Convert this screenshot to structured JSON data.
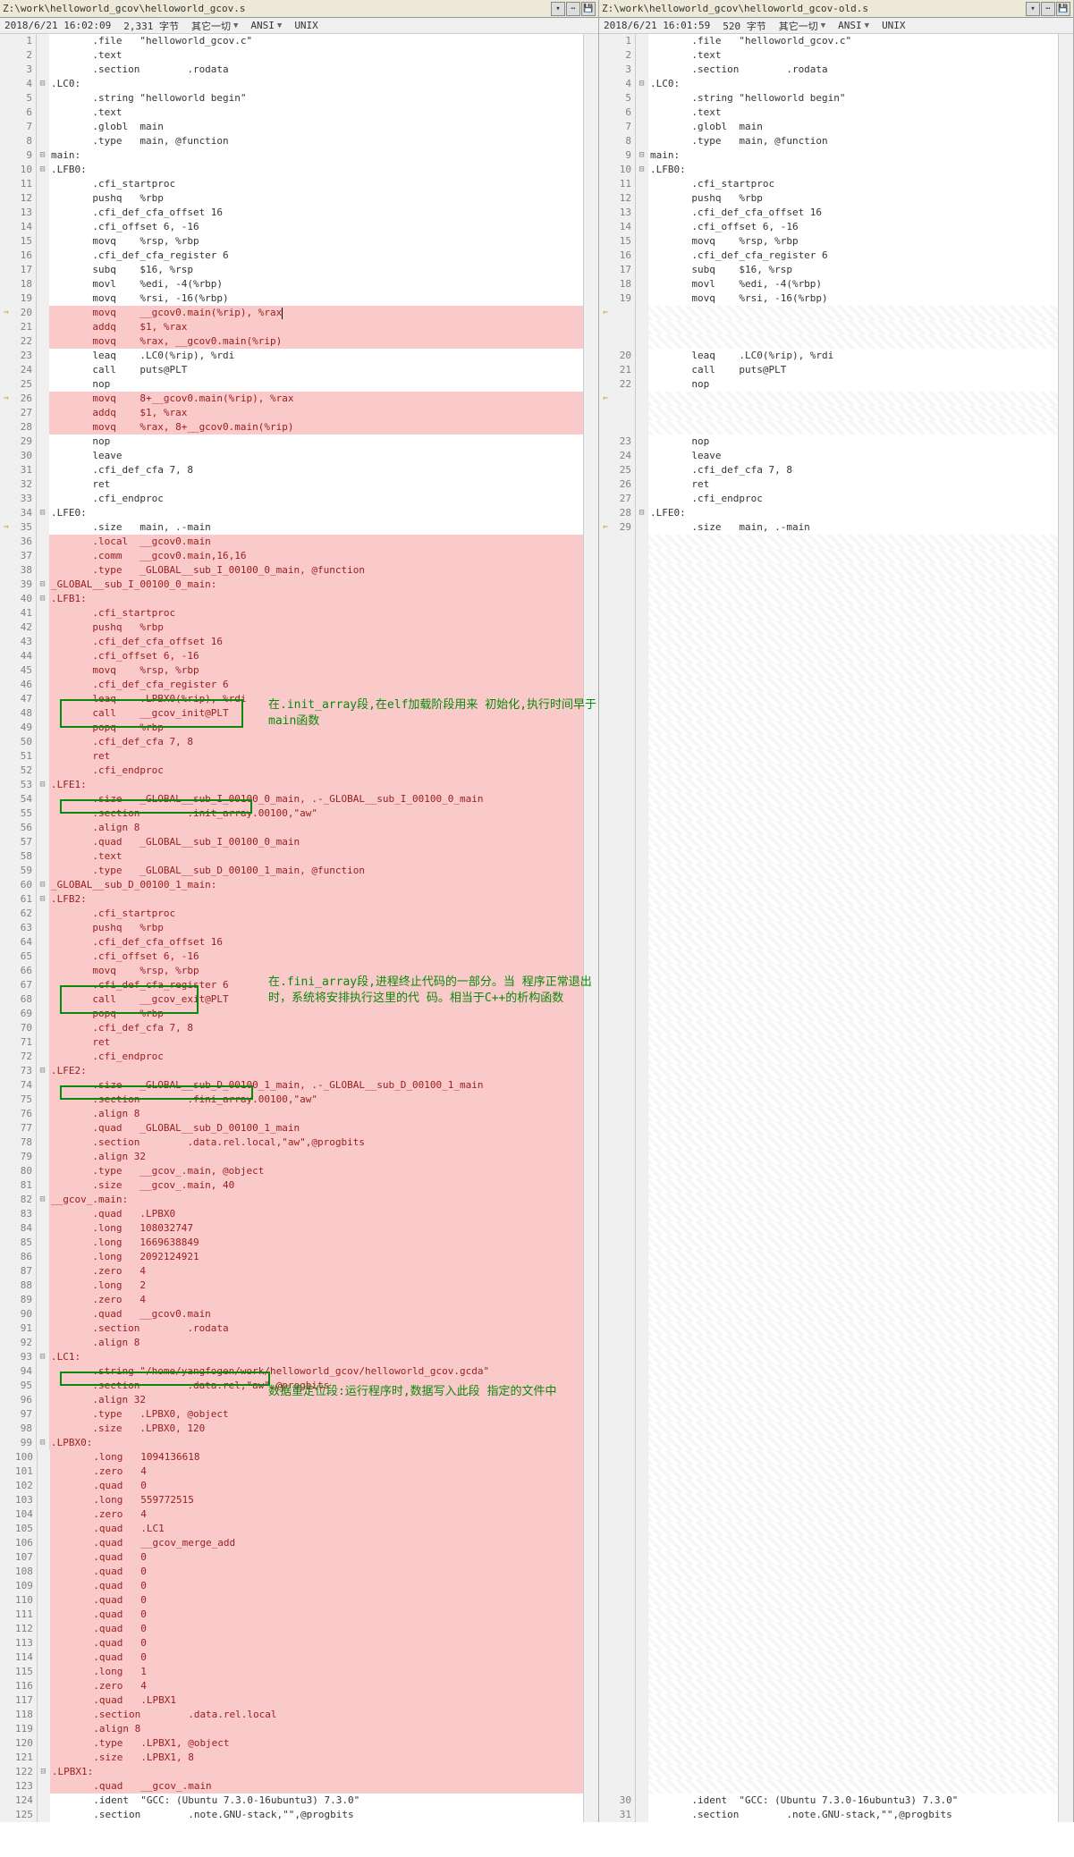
{
  "left": {
    "path": "Z:\\work\\helloworld_gcov\\helloworld_gcov.s",
    "status": {
      "date": "2018/6/21 16:02:09",
      "bytes": "2,331 字节",
      "menu": "其它一切",
      "enc": "ANSI",
      "eol": "UNIX"
    },
    "annotations": {
      "a1": "在.init_array段,在elf加载阶段用来\n初始化,执行时间早于main函数",
      "a2": "在.fini_array段,进程终止代码的一部分。当\n程序正常退出时，系统将安排执行这里的代\n码。相当于C++的析构函数",
      "a3": "数据重定位段:运行程序时,数据写入此段\n指定的文件中"
    },
    "lines": [
      {
        "n": 1,
        "t": "       .file   \"helloworld_gcov.c\"",
        "c": "norm"
      },
      {
        "n": 2,
        "t": "       .text",
        "c": "norm"
      },
      {
        "n": 3,
        "t": "       .section        .rodata",
        "c": "norm"
      },
      {
        "n": 4,
        "t": ".LC0:",
        "c": "norm"
      },
      {
        "n": 5,
        "t": "       .string \"helloworld begin\"",
        "c": "norm"
      },
      {
        "n": 6,
        "t": "       .text",
        "c": "norm"
      },
      {
        "n": 7,
        "t": "       .globl  main",
        "c": "norm"
      },
      {
        "n": 8,
        "t": "       .type   main, @function",
        "c": "norm"
      },
      {
        "n": 9,
        "t": "main:",
        "c": "norm"
      },
      {
        "n": 10,
        "t": ".LFB0:",
        "c": "norm"
      },
      {
        "n": 11,
        "t": "       .cfi_startproc",
        "c": "norm"
      },
      {
        "n": 12,
        "t": "       pushq   %rbp",
        "c": "norm"
      },
      {
        "n": 13,
        "t": "       .cfi_def_cfa_offset 16",
        "c": "norm"
      },
      {
        "n": 14,
        "t": "       .cfi_offset 6, -16",
        "c": "norm"
      },
      {
        "n": 15,
        "t": "       movq    %rsp, %rbp",
        "c": "norm"
      },
      {
        "n": 16,
        "t": "       .cfi_def_cfa_register 6",
        "c": "norm"
      },
      {
        "n": 17,
        "t": "       subq    $16, %rsp",
        "c": "norm"
      },
      {
        "n": 18,
        "t": "       movl    %edi, -4(%rbp)",
        "c": "norm"
      },
      {
        "n": 19,
        "t": "       movq    %rsi, -16(%rbp)",
        "c": "norm"
      },
      {
        "n": 20,
        "t": "       movq    __gcov0.main(%rip), %rax",
        "bg": "red",
        "ic": "⇒",
        "cur": true
      },
      {
        "n": 21,
        "t": "       addq    $1, %rax",
        "bg": "red"
      },
      {
        "n": 22,
        "t": "       movq    %rax, __gcov0.main(%rip)",
        "bg": "red"
      },
      {
        "n": 23,
        "t": "       leaq    .LC0(%rip), %rdi",
        "c": "norm"
      },
      {
        "n": 24,
        "t": "       call    puts@PLT",
        "c": "norm"
      },
      {
        "n": 25,
        "t": "       nop",
        "c": "norm"
      },
      {
        "n": 26,
        "t": "       movq    8+__gcov0.main(%rip), %rax",
        "bg": "red",
        "ic": "⇒"
      },
      {
        "n": 27,
        "t": "       addq    $1, %rax",
        "bg": "red"
      },
      {
        "n": 28,
        "t": "       movq    %rax, 8+__gcov0.main(%rip)",
        "bg": "red"
      },
      {
        "n": 29,
        "t": "       nop",
        "c": "norm"
      },
      {
        "n": 30,
        "t": "       leave",
        "c": "norm"
      },
      {
        "n": 31,
        "t": "       .cfi_def_cfa 7, 8",
        "c": "norm"
      },
      {
        "n": 32,
        "t": "       ret",
        "c": "norm"
      },
      {
        "n": 33,
        "t": "       .cfi_endproc",
        "c": "norm"
      },
      {
        "n": 34,
        "t": ".LFE0:",
        "c": "norm"
      },
      {
        "n": 35,
        "t": "       .size   main, .-main",
        "c": "norm",
        "ic": "⇒"
      },
      {
        "n": 36,
        "t": "       .local  __gcov0.main",
        "bg": "red"
      },
      {
        "n": 37,
        "t": "       .comm   __gcov0.main,16,16",
        "bg": "red"
      },
      {
        "n": 38,
        "t": "       .type   _GLOBAL__sub_I_00100_0_main, @function",
        "bg": "red"
      },
      {
        "n": 39,
        "t": "_GLOBAL__sub_I_00100_0_main:",
        "bg": "red"
      },
      {
        "n": 40,
        "t": ".LFB1:",
        "bg": "red"
      },
      {
        "n": 41,
        "t": "       .cfi_startproc",
        "bg": "red"
      },
      {
        "n": 42,
        "t": "       pushq   %rbp",
        "bg": "red"
      },
      {
        "n": 43,
        "t": "       .cfi_def_cfa_offset 16",
        "bg": "red"
      },
      {
        "n": 44,
        "t": "       .cfi_offset 6, -16",
        "bg": "red"
      },
      {
        "n": 45,
        "t": "       movq    %rsp, %rbp",
        "bg": "red"
      },
      {
        "n": 46,
        "t": "       .cfi_def_cfa_register 6",
        "bg": "red"
      },
      {
        "n": 47,
        "t": "       leaq    .LPBX0(%rip), %rdi",
        "bg": "red"
      },
      {
        "n": 48,
        "t": "       call    __gcov_init@PLT",
        "bg": "red"
      },
      {
        "n": 49,
        "t": "       popq    %rbp",
        "bg": "red"
      },
      {
        "n": 50,
        "t": "       .cfi_def_cfa 7, 8",
        "bg": "red"
      },
      {
        "n": 51,
        "t": "       ret",
        "bg": "red"
      },
      {
        "n": 52,
        "t": "       .cfi_endproc",
        "bg": "red"
      },
      {
        "n": 53,
        "t": ".LFE1:",
        "bg": "red"
      },
      {
        "n": 54,
        "t": "       .size   _GLOBAL__sub_I_00100_0_main, .-_GLOBAL__sub_I_00100_0_main",
        "bg": "red"
      },
      {
        "n": 55,
        "t": "       .section        .init_array.00100,\"aw\"",
        "bg": "red"
      },
      {
        "n": 56,
        "t": "       .align 8",
        "bg": "red"
      },
      {
        "n": 57,
        "t": "       .quad   _GLOBAL__sub_I_00100_0_main",
        "bg": "red"
      },
      {
        "n": 58,
        "t": "       .text",
        "bg": "red"
      },
      {
        "n": 59,
        "t": "       .type   _GLOBAL__sub_D_00100_1_main, @function",
        "bg": "red"
      },
      {
        "n": 60,
        "t": "_GLOBAL__sub_D_00100_1_main:",
        "bg": "red"
      },
      {
        "n": 61,
        "t": ".LFB2:",
        "bg": "red"
      },
      {
        "n": 62,
        "t": "       .cfi_startproc",
        "bg": "red"
      },
      {
        "n": 63,
        "t": "       pushq   %rbp",
        "bg": "red"
      },
      {
        "n": 64,
        "t": "       .cfi_def_cfa_offset 16",
        "bg": "red"
      },
      {
        "n": 65,
        "t": "       .cfi_offset 6, -16",
        "bg": "red"
      },
      {
        "n": 66,
        "t": "       movq    %rsp, %rbp",
        "bg": "red"
      },
      {
        "n": 67,
        "t": "       .cfi_def_cfa_register 6",
        "bg": "red"
      },
      {
        "n": 68,
        "t": "       call    __gcov_exit@PLT",
        "bg": "red"
      },
      {
        "n": 69,
        "t": "       popq    %rbp",
        "bg": "red"
      },
      {
        "n": 70,
        "t": "       .cfi_def_cfa 7, 8",
        "bg": "red"
      },
      {
        "n": 71,
        "t": "       ret",
        "bg": "red"
      },
      {
        "n": 72,
        "t": "       .cfi_endproc",
        "bg": "red"
      },
      {
        "n": 73,
        "t": ".LFE2:",
        "bg": "red"
      },
      {
        "n": 74,
        "t": "       .size   _GLOBAL__sub_D_00100_1_main, .-_GLOBAL__sub_D_00100_1_main",
        "bg": "red"
      },
      {
        "n": 75,
        "t": "       .section        .fini_array.00100,\"aw\"",
        "bg": "red"
      },
      {
        "n": 76,
        "t": "       .align 8",
        "bg": "red"
      },
      {
        "n": 77,
        "t": "       .quad   _GLOBAL__sub_D_00100_1_main",
        "bg": "red"
      },
      {
        "n": 78,
        "t": "       .section        .data.rel.local,\"aw\",@progbits",
        "bg": "red"
      },
      {
        "n": 79,
        "t": "       .align 32",
        "bg": "red"
      },
      {
        "n": 80,
        "t": "       .type   __gcov_.main, @object",
        "bg": "red"
      },
      {
        "n": 81,
        "t": "       .size   __gcov_.main, 40",
        "bg": "red"
      },
      {
        "n": 82,
        "t": "__gcov_.main:",
        "bg": "red"
      },
      {
        "n": 83,
        "t": "       .quad   .LPBX0",
        "bg": "red"
      },
      {
        "n": 84,
        "t": "       .long   108032747",
        "bg": "red"
      },
      {
        "n": 85,
        "t": "       .long   1669638849",
        "bg": "red"
      },
      {
        "n": 86,
        "t": "       .long   2092124921",
        "bg": "red"
      },
      {
        "n": 87,
        "t": "       .zero   4",
        "bg": "red"
      },
      {
        "n": 88,
        "t": "       .long   2",
        "bg": "red"
      },
      {
        "n": 89,
        "t": "       .zero   4",
        "bg": "red"
      },
      {
        "n": 90,
        "t": "       .quad   __gcov0.main",
        "bg": "red"
      },
      {
        "n": 91,
        "t": "       .section        .rodata",
        "bg": "red"
      },
      {
        "n": 92,
        "t": "       .align 8",
        "bg": "red"
      },
      {
        "n": 93,
        "t": ".LC1:",
        "bg": "red"
      },
      {
        "n": 94,
        "t": "       .string \"/home/yangfogen/work/helloworld_gcov/helloworld_gcov.gcda\"",
        "bg": "red"
      },
      {
        "n": 95,
        "t": "       .section        .data.rel,\"aw\",@progbits",
        "bg": "red"
      },
      {
        "n": 96,
        "t": "       .align 32",
        "bg": "red"
      },
      {
        "n": 97,
        "t": "       .type   .LPBX0, @object",
        "bg": "red"
      },
      {
        "n": 98,
        "t": "       .size   .LPBX0, 120",
        "bg": "red"
      },
      {
        "n": 99,
        "t": ".LPBX0:",
        "bg": "red"
      },
      {
        "n": 100,
        "t": "       .long   1094136618",
        "bg": "red"
      },
      {
        "n": 101,
        "t": "       .zero   4",
        "bg": "red"
      },
      {
        "n": 102,
        "t": "       .quad   0",
        "bg": "red"
      },
      {
        "n": 103,
        "t": "       .long   559772515",
        "bg": "red"
      },
      {
        "n": 104,
        "t": "       .zero   4",
        "bg": "red"
      },
      {
        "n": 105,
        "t": "       .quad   .LC1",
        "bg": "red"
      },
      {
        "n": 106,
        "t": "       .quad   __gcov_merge_add",
        "bg": "red"
      },
      {
        "n": 107,
        "t": "       .quad   0",
        "bg": "red"
      },
      {
        "n": 108,
        "t": "       .quad   0",
        "bg": "red"
      },
      {
        "n": 109,
        "t": "       .quad   0",
        "bg": "red"
      },
      {
        "n": 110,
        "t": "       .quad   0",
        "bg": "red"
      },
      {
        "n": 111,
        "t": "       .quad   0",
        "bg": "red"
      },
      {
        "n": 112,
        "t": "       .quad   0",
        "bg": "red"
      },
      {
        "n": 113,
        "t": "       .quad   0",
        "bg": "red"
      },
      {
        "n": 114,
        "t": "       .quad   0",
        "bg": "red"
      },
      {
        "n": 115,
        "t": "       .long   1",
        "bg": "red"
      },
      {
        "n": 116,
        "t": "       .zero   4",
        "bg": "red"
      },
      {
        "n": 117,
        "t": "       .quad   .LPBX1",
        "bg": "red"
      },
      {
        "n": 118,
        "t": "       .section        .data.rel.local",
        "bg": "red"
      },
      {
        "n": 119,
        "t": "       .align 8",
        "bg": "red"
      },
      {
        "n": 120,
        "t": "       .type   .LPBX1, @object",
        "bg": "red"
      },
      {
        "n": 121,
        "t": "       .size   .LPBX1, 8",
        "bg": "red"
      },
      {
        "n": 122,
        "t": ".LPBX1:",
        "bg": "red"
      },
      {
        "n": 123,
        "t": "       .quad   __gcov_.main",
        "bg": "red"
      },
      {
        "n": 124,
        "t": "       .ident  \"GCC: (Ubuntu 7.3.0-16ubuntu3) 7.3.0\"",
        "c": "norm"
      },
      {
        "n": 125,
        "t": "       .section        .note.GNU-stack,\"\",@progbits",
        "c": "norm"
      }
    ]
  },
  "right": {
    "path": "Z:\\work\\helloworld_gcov\\helloworld_gcov-old.s",
    "status": {
      "date": "2018/6/21 16:01:59",
      "bytes": "520 字节",
      "menu": "其它一切",
      "enc": "ANSI",
      "eol": "UNIX"
    },
    "lines": [
      {
        "n": 1,
        "t": "       .file   \"helloworld_gcov.c\"",
        "c": "norm"
      },
      {
        "n": 2,
        "t": "       .text",
        "c": "norm"
      },
      {
        "n": 3,
        "t": "       .section        .rodata",
        "c": "norm"
      },
      {
        "n": 4,
        "t": ".LC0:",
        "c": "norm"
      },
      {
        "n": 5,
        "t": "       .string \"helloworld begin\"",
        "c": "norm"
      },
      {
        "n": 6,
        "t": "       .text",
        "c": "norm"
      },
      {
        "n": 7,
        "t": "       .globl  main",
        "c": "norm"
      },
      {
        "n": 8,
        "t": "       .type   main, @function",
        "c": "norm"
      },
      {
        "n": 9,
        "t": "main:",
        "c": "norm"
      },
      {
        "n": 10,
        "t": ".LFB0:",
        "c": "norm"
      },
      {
        "n": 11,
        "t": "       .cfi_startproc",
        "c": "norm"
      },
      {
        "n": 12,
        "t": "       pushq   %rbp",
        "c": "norm"
      },
      {
        "n": 13,
        "t": "       .cfi_def_cfa_offset 16",
        "c": "norm"
      },
      {
        "n": 14,
        "t": "       .cfi_offset 6, -16",
        "c": "norm"
      },
      {
        "n": 15,
        "t": "       movq    %rsp, %rbp",
        "c": "norm"
      },
      {
        "n": 16,
        "t": "       .cfi_def_cfa_register 6",
        "c": "norm"
      },
      {
        "n": 17,
        "t": "       subq    $16, %rsp",
        "c": "norm"
      },
      {
        "n": 18,
        "t": "       movl    %edi, -4(%rbp)",
        "c": "norm"
      },
      {
        "n": 19,
        "t": "       movq    %rsi, -16(%rbp)",
        "c": "norm"
      },
      {
        "n": "",
        "t": "",
        "bg": "hatch",
        "ic": "⇐"
      },
      {
        "n": "",
        "t": "",
        "bg": "hatch"
      },
      {
        "n": "",
        "t": "",
        "bg": "hatch"
      },
      {
        "n": 20,
        "t": "       leaq    .LC0(%rip), %rdi",
        "c": "norm"
      },
      {
        "n": 21,
        "t": "       call    puts@PLT",
        "c": "norm"
      },
      {
        "n": 22,
        "t": "       nop",
        "c": "norm"
      },
      {
        "n": "",
        "t": "",
        "bg": "hatch",
        "ic": "⇐"
      },
      {
        "n": "",
        "t": "",
        "bg": "hatch"
      },
      {
        "n": "",
        "t": "",
        "bg": "hatch"
      },
      {
        "n": 23,
        "t": "       nop",
        "c": "norm"
      },
      {
        "n": 24,
        "t": "       leave",
        "c": "norm"
      },
      {
        "n": 25,
        "t": "       .cfi_def_cfa 7, 8",
        "c": "norm"
      },
      {
        "n": 26,
        "t": "       ret",
        "c": "norm"
      },
      {
        "n": 27,
        "t": "       .cfi_endproc",
        "c": "norm"
      },
      {
        "n": 28,
        "t": ".LFE0:",
        "c": "norm"
      },
      {
        "n": 29,
        "t": "       .size   main, .-main",
        "c": "norm",
        "ic": "⇐"
      },
      {
        "n": "",
        "t": "",
        "bg": "hatch",
        "h": 88
      },
      {
        "n": 30,
        "t": "       .ident  \"GCC: (Ubuntu 7.3.0-16ubuntu3) 7.3.0\"",
        "c": "norm"
      },
      {
        "n": 31,
        "t": "       .section        .note.GNU-stack,\"\",@progbits",
        "c": "norm"
      }
    ]
  }
}
